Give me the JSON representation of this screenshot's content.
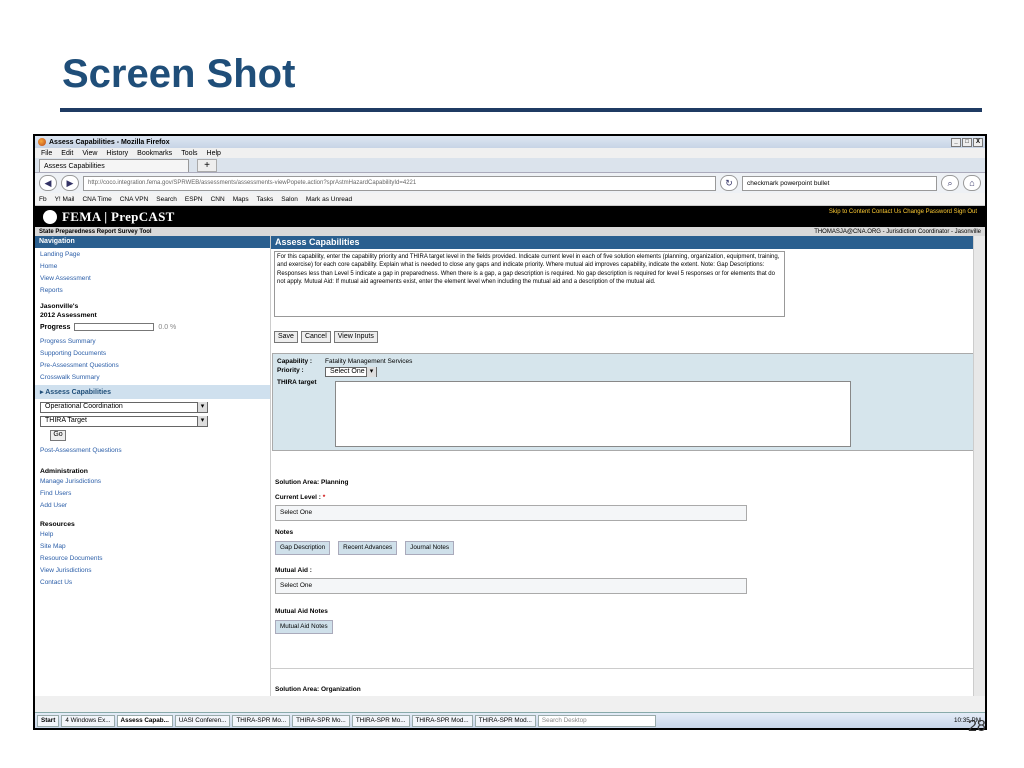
{
  "slide": {
    "title": "Screen Shot",
    "page_number": "28"
  },
  "window": {
    "title": "Assess Capabilities - Mozilla Firefox",
    "controls": [
      "_",
      "□",
      "X"
    ]
  },
  "menu": [
    "File",
    "Edit",
    "View",
    "History",
    "Bookmarks",
    "Tools",
    "Help"
  ],
  "tab": {
    "label": "Assess Capabilities",
    "new_tab": "+"
  },
  "url": "http://coco.integration.fema.gov/SPRWEB/assessments/assessments-viewPopete.action?sprAstmHazardCapabilityId=4221",
  "search_value": "checkmark powerpoint bullet",
  "bookmarks": [
    "Fb",
    "Y! Mail",
    "CNA Time",
    "CNA VPN",
    "Search",
    "ESPN",
    "CNN",
    "Maps",
    "Tasks",
    "Salon",
    "Mark as Unread"
  ],
  "header": {
    "logo": "FEMA | PrepCAST",
    "links": "Skip to Content  Contact Us  Change Password  Sign Out"
  },
  "subheader": {
    "app": "State Preparedness Report Survey Tool",
    "user": "THOMASJA@CNA.ORG - Jurisdiction Coordinator - Jasonville"
  },
  "nav": {
    "heading": "Navigation",
    "top_links": [
      "Landing Page",
      "Home",
      "View Assessment",
      "Reports"
    ],
    "jurisdiction": "Jasonville's",
    "assessment": "2012 Assessment",
    "progress_label": "Progress",
    "progress_value": "0.0 %",
    "assess_links": [
      "Progress Summary",
      "Supporting Documents",
      "Pre-Assessment Questions",
      "Crosswalk Summary"
    ],
    "active_item": "Assess Capabilities",
    "select1": "Operational Coordination",
    "select2": "THIRA Target",
    "go": "Go",
    "post_link": "Post-Assessment Questions",
    "admin_heading": "Administration",
    "admin_links": [
      "Manage Jurisdictions",
      "Find Users",
      "Add User"
    ],
    "resources_heading": "Resources",
    "resources_links": [
      "Help",
      "Site Map",
      "Resource Documents",
      "View Jurisdictions",
      "Contact Us"
    ]
  },
  "main": {
    "heading": "Assess Capabilities",
    "instructions": "For this capability, enter the capability priority and THIRA target level in the fields provided. Indicate current level in each of five solution elements (planning, organization, equipment, training, and exercise) for each core capability. Explain what is needed to close any gaps and indicate priority. Where mutual aid improves capability, indicate the extent. Note: Gap Descriptions: Responses less than Level 5 indicate a gap in preparedness. When there is a gap, a gap description is required. No gap description is required for level 5 responses or for elements that do not apply. Mutual Aid: If mutual aid agreements exist, enter the element level when including the mutual aid and a description of the mutual aid.",
    "buttons": [
      "Save",
      "Cancel",
      "View Inputs"
    ],
    "capability_label": "Capability :",
    "capability_value": "Fatality Management Services",
    "priority_label": "Priority :",
    "priority_value": "Select One",
    "thira_label": "THIRA target",
    "solution_area": "Solution Area: Planning",
    "current_level_label": "Current Level :",
    "current_level_value": "Select One",
    "notes_label": "Notes",
    "note_buttons": [
      "Gap Description",
      "Recent Advances",
      "Journal Notes"
    ],
    "mutual_aid_label": "Mutual Aid :",
    "mutual_aid_value": "Select One",
    "mutual_aid_notes_label": "Mutual Aid Notes",
    "mutual_aid_notes_button": "Mutual Aid Notes",
    "next_solution_area": "Solution Area: Organization"
  },
  "taskbar": {
    "start": "Start",
    "items": [
      "4 Windows Ex...",
      "Assess Capab...",
      "UASI Conferen...",
      "THIRA-SPR Mo...",
      "THIRA-SPR Mo...",
      "THIRA-SPR Mo...",
      "THIRA-SPR Mod...",
      "THIRA-SPR Mod..."
    ],
    "search": "Search Desktop",
    "clock": "10:35 PM"
  }
}
